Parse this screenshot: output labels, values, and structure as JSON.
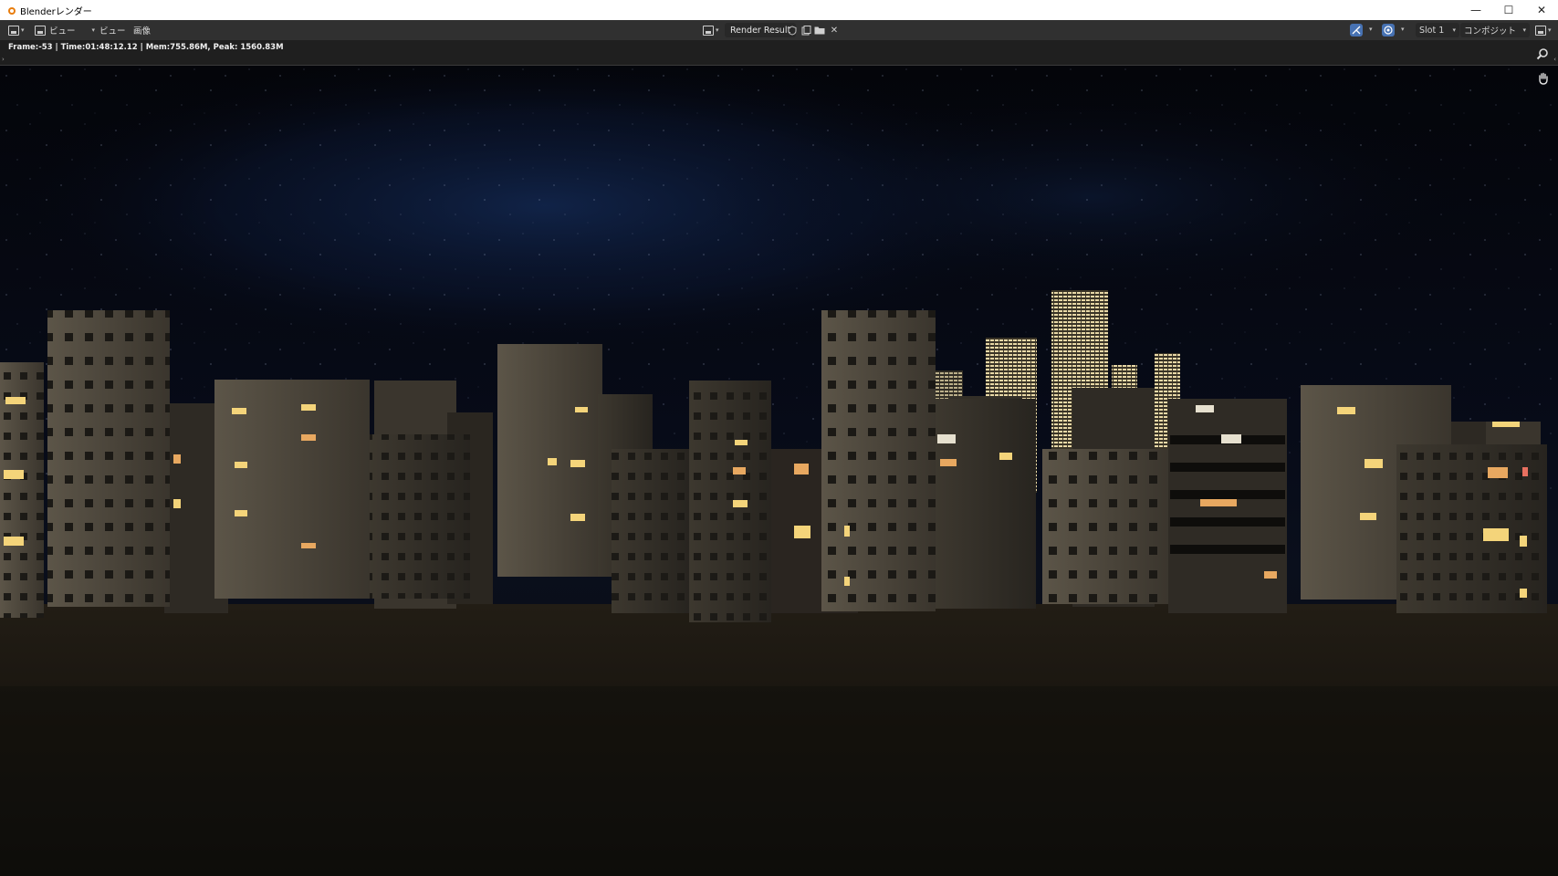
{
  "window": {
    "title": "Blenderレンダー",
    "minimize": "—",
    "maximize": "☐",
    "close": "✕"
  },
  "header": {
    "view_menu_1": "ビュー",
    "view_menu_2": "ビュー",
    "image_menu": "画像",
    "render_result": "Render Result",
    "slot": "Slot 1",
    "composite": "コンポジット"
  },
  "stats": {
    "text": "Frame:-53 | Time:01:48:12.12 | Mem:755.86M, Peak: 1560.83M"
  },
  "icons": {
    "editor_type": "image-editor-icon",
    "image_icon": "image-icon",
    "shield": "fake-user-icon",
    "new_image": "new-image-icon",
    "open_folder": "open-folder-icon",
    "unlink": "unlink-x-icon",
    "gizmo": "gizmo-icon",
    "overlay": "overlay-icon",
    "display_mode": "display-mode-icon",
    "zoom": "zoom-icon",
    "pan": "hand-icon"
  },
  "colors": {
    "header_bg": "#303030",
    "stats_bg": "#1f1f1f",
    "accent_blue": "#4772b3",
    "sky_top": "#05070f",
    "sky_glow": "#0d1a3a",
    "ground": "#16130e"
  }
}
